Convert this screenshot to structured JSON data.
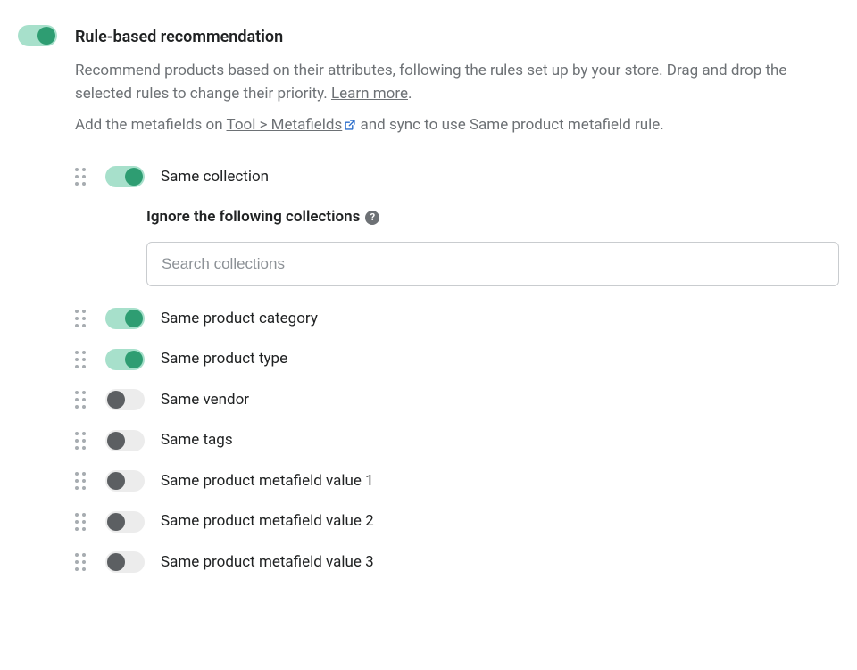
{
  "header": {
    "title": "Rule-based recommendation",
    "master_toggle_on": true,
    "desc1": "Recommend products based on their attributes, following the rules set up by your store. Drag and drop the selected rules to change their priority. ",
    "learn_more": "Learn more",
    "desc2a": "Add the metafields on ",
    "metafields_link": "Tool > Metafields",
    "desc2b": " and sync to use Same product metafield rule."
  },
  "ignore": {
    "label": "Ignore the following collections",
    "placeholder": "Search collections"
  },
  "rules": [
    {
      "label": "Same collection",
      "on": true,
      "has_ignore": true
    },
    {
      "label": "Same product category",
      "on": true
    },
    {
      "label": "Same product type",
      "on": true
    },
    {
      "label": "Same vendor",
      "on": false
    },
    {
      "label": "Same tags",
      "on": false
    },
    {
      "label": "Same product metafield value 1",
      "on": false
    },
    {
      "label": "Same product metafield value 2",
      "on": false
    },
    {
      "label": "Same product metafield value 3",
      "on": false
    }
  ]
}
